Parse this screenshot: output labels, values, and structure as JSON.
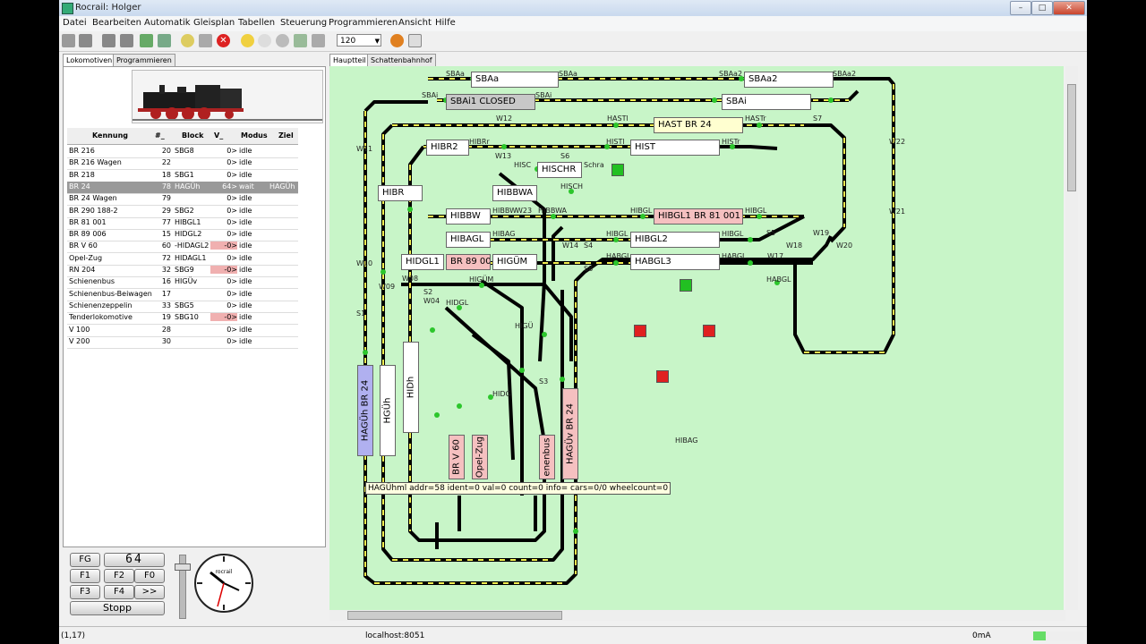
{
  "window": {
    "title": "Rocrail: Holger"
  },
  "menu": [
    "Datei",
    "Bearbeiten",
    "Automatik",
    "Gleisplan",
    "Tabellen",
    "Steuerung",
    "Programmieren",
    "Ansicht",
    "Hilfe"
  ],
  "toolbar": {
    "zoom": "120"
  },
  "left_tabs": [
    "Lokomotiven",
    "Programmieren"
  ],
  "plan_tabs": [
    "Hauptteil",
    "Schattenbahnhof"
  ],
  "loco_table": {
    "headers": [
      "Kennung",
      "#_",
      "Block",
      "V_",
      "Modus",
      "Ziel"
    ],
    "rows": [
      {
        "id": "BR 216",
        "addr": "20",
        "block": "SBG8",
        "v": "0>",
        "mode": "idle",
        "dest": ""
      },
      {
        "id": "BR 216 Wagen",
        "addr": "22",
        "block": "",
        "v": "0>",
        "mode": "idle",
        "dest": ""
      },
      {
        "id": "BR 218",
        "addr": "18",
        "block": "SBG1",
        "v": "0>",
        "mode": "idle",
        "dest": ""
      },
      {
        "id": "BR 24",
        "addr": "78",
        "block": "HAGÜh",
        "v": "64>",
        "mode": "wait",
        "dest": "HAGÜh"
      },
      {
        "id": "BR 24 Wagen",
        "addr": "79",
        "block": "",
        "v": "0>",
        "mode": "idle",
        "dest": ""
      },
      {
        "id": "BR 290 188-2",
        "addr": "29",
        "block": "SBG2",
        "v": "0>",
        "mode": "idle",
        "dest": ""
      },
      {
        "id": "BR 81 001",
        "addr": "77",
        "block": "HIBGL1",
        "v": "0>",
        "mode": "idle",
        "dest": ""
      },
      {
        "id": "BR 89 006",
        "addr": "15",
        "block": "HIDGL2",
        "v": "0>",
        "mode": "idle",
        "dest": ""
      },
      {
        "id": "BR V 60",
        "addr": "60",
        "block": "-HIDAGL2",
        "v": "-0>",
        "mode": "idle",
        "dest": ""
      },
      {
        "id": "Opel-Zug",
        "addr": "72",
        "block": "HIDAGL1",
        "v": "0>",
        "mode": "idle",
        "dest": ""
      },
      {
        "id": "RN 204",
        "addr": "32",
        "block": "SBG9",
        "v": "-0>",
        "mode": "idle",
        "dest": ""
      },
      {
        "id": "Schienenbus",
        "addr": "16",
        "block": "HIGÜv",
        "v": "0>",
        "mode": "idle",
        "dest": ""
      },
      {
        "id": "Schienenbus-Beiwagen",
        "addr": "17",
        "block": "",
        "v": "0>",
        "mode": "idle",
        "dest": ""
      },
      {
        "id": "Schienenzeppelin",
        "addr": "33",
        "block": "SBG5",
        "v": "0>",
        "mode": "idle",
        "dest": ""
      },
      {
        "id": "Tenderlokomotive",
        "addr": "19",
        "block": "SBG10",
        "v": "-0>",
        "mode": "idle",
        "dest": ""
      },
      {
        "id": "V 100",
        "addr": "28",
        "block": "",
        "v": "0>",
        "mode": "idle",
        "dest": ""
      },
      {
        "id": "V 200",
        "addr": "30",
        "block": "",
        "v": "0>",
        "mode": "idle",
        "dest": ""
      }
    ]
  },
  "cockpit": {
    "fg": "FG",
    "speed": "64",
    "f1": "F1",
    "f2": "F2",
    "f0": "F0",
    "f3": "F3",
    "f4": "F4",
    "more": ">>",
    "stop": "Stopp",
    "clock_brand": "rocrail"
  },
  "blocks": [
    {
      "name": "SBAa",
      "text": "SBAa"
    },
    {
      "name": "SBAa2",
      "text": "SBAa2"
    },
    {
      "name": "SBAi1",
      "text": "SBAi1 CLOSED"
    },
    {
      "name": "SBAi",
      "text": "SBAi"
    },
    {
      "name": "HAST",
      "text": "HAST BR 24"
    },
    {
      "name": "HIBR2",
      "text": "HIBR2"
    },
    {
      "name": "HIST",
      "text": "HIST"
    },
    {
      "name": "HISCHR",
      "text": "HISCHR"
    },
    {
      "name": "HIBR",
      "text": "HIBR"
    },
    {
      "name": "HIBBWA",
      "text": "HIBBWA"
    },
    {
      "name": "HIBBW",
      "text": "HIBBW"
    },
    {
      "name": "HIBGL1",
      "text": "HIBGL1 BR 81 001"
    },
    {
      "name": "HIBAGL",
      "text": "HIBAGL"
    },
    {
      "name": "HIBGL2",
      "text": "HIBGL2"
    },
    {
      "name": "HIDGL1",
      "text": "HIDGL1"
    },
    {
      "name": "HIDGL2",
      "text": "BR 89 006"
    },
    {
      "name": "HIGUM",
      "text": "HIGÜM"
    },
    {
      "name": "HABGL3",
      "text": "HABGL3"
    },
    {
      "name": "HAGUh",
      "text": "HAGÜh BR 24"
    },
    {
      "name": "HGUh",
      "text": "HGÜh"
    },
    {
      "name": "HIDh",
      "text": "HIDh"
    },
    {
      "name": "BRV60",
      "text": "BR V 60"
    },
    {
      "name": "OpelZug",
      "text": "Opel-Zug"
    },
    {
      "name": "Schienenbus",
      "text": "enenbus"
    },
    {
      "name": "HAGUvBR24",
      "text": "HAGÜv BR 24"
    }
  ],
  "labels": {
    "w12": "W12",
    "w13": "W13",
    "w11": "W11",
    "w10": "W10",
    "w09": "W09",
    "w08": "W08",
    "w04": "W04",
    "w14": "W14",
    "w18": "W18",
    "w19": "W19",
    "w20": "W20",
    "w17": "W17",
    "w22": "W22",
    "w21": "W21",
    "w23": "W23",
    "s1": "S1",
    "s2": "S2",
    "s3": "S3",
    "s4": "S4",
    "s5": "S5",
    "s6": "S6",
    "s7": "S7",
    "s8": "S8",
    "sbaa_l": "SBAa",
    "sbaa_r": "SBAa",
    "sbai_l": "SBAi",
    "sbai_r": "SBAi",
    "sbaa2_l": "SBAa2",
    "sbaa2_r": "SBAa2",
    "hastl": "HASTl",
    "hastr": "HASTr",
    "hibrr": "HIBRr",
    "histl": "HISTl",
    "histr": "HISTr",
    "hisc": "HISC",
    "hisch": "HISCH",
    "schra": "Schra",
    "hibbw": "HIBBW",
    "hibbwa": "HIBBWA",
    "hibgl_l": "HIBGL",
    "hibgl_r": "HIBGL",
    "hibag": "HIBAG",
    "hibgl2l": "HIBGL",
    "hibgl2r": "HIBGL",
    "habgl_l": "HABGL",
    "habgl_r": "HABGL",
    "habgl_b": "HABGL",
    "hidgl": "HIDGL",
    "higum": "HIGÜM",
    "higu": "HIGÜ",
    "hidg": "HIDG",
    "hibag2": "HIBAG"
  },
  "tooltip": "HAGÜhml addr=58 ident=0 val=0 count=0 info= cars=0/0 wheelcount=0",
  "status": {
    "coords": "(1,17)",
    "host": "localhost:8051",
    "current": "0mA"
  }
}
